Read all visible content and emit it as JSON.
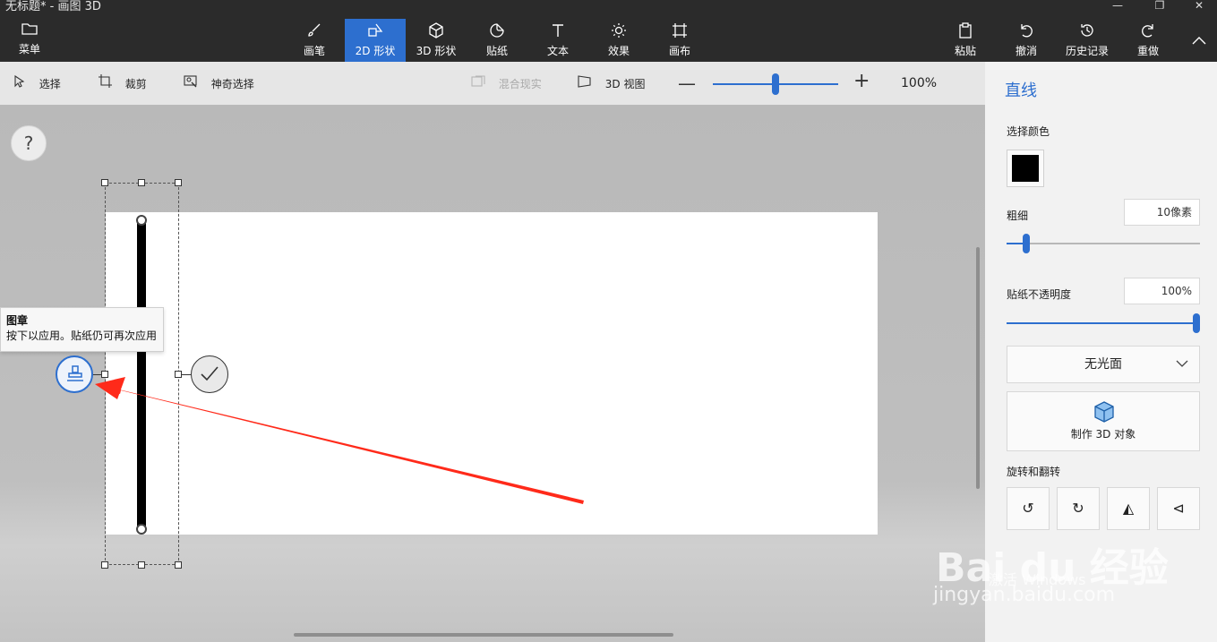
{
  "window": {
    "title": "无标题* - 画图 3D",
    "minimize": "—",
    "restore": "❐",
    "close": "✕"
  },
  "menu": {
    "label": "菜单"
  },
  "tools": [
    {
      "label": "画笔",
      "icon": "brush-icon"
    },
    {
      "label": "2D 形状",
      "icon": "2d-shapes-icon",
      "active": true
    },
    {
      "label": "3D 形状",
      "icon": "3d-cube-icon"
    },
    {
      "label": "贴纸",
      "icon": "sticker-icon"
    },
    {
      "label": "文本",
      "icon": "text-icon"
    },
    {
      "label": "效果",
      "icon": "effects-sun-icon"
    },
    {
      "label": "画布",
      "icon": "canvas-crop-icon"
    }
  ],
  "actions": [
    {
      "label": "粘贴",
      "icon": "paste-icon"
    },
    {
      "label": "撤消",
      "icon": "undo-icon"
    },
    {
      "label": "历史记录",
      "icon": "history-icon"
    },
    {
      "label": "重做",
      "icon": "redo-icon"
    }
  ],
  "subbar": {
    "select": "选择",
    "crop": "裁剪",
    "magic_select": "神奇选择",
    "mixed_reality": "混合现实",
    "view3d": "3D 视图",
    "zoom_value": "100%",
    "zoom_level": 0.5,
    "more": "···"
  },
  "canvas": {
    "help": "?"
  },
  "tooltip": {
    "title": "图章",
    "body": "按下以应用。贴纸仍可再次应用"
  },
  "panel": {
    "title": "直线",
    "color_label": "选择颜色",
    "color": "#000000",
    "thickness_label": "粗细",
    "thickness_value": "10像素",
    "thickness_level": 0.1,
    "opacity_label": "贴纸不透明度",
    "opacity_value": "100%",
    "opacity_level": 1.0,
    "finish": "无光面",
    "make3d": "制作 3D 对象",
    "rotate_label": "旋转和翻转"
  },
  "watermark": {
    "brand": "Bai du 经验",
    "sub": "jingyan.baidu.com",
    "activate": "激活 Windows"
  },
  "colors": {
    "accent": "#2d6fcf",
    "annotation_arrow": "#ff2a1a"
  }
}
